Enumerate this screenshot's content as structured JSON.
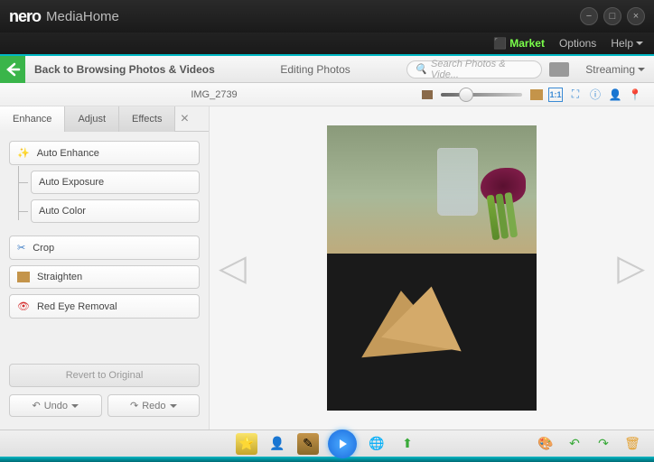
{
  "app": {
    "brand": "nero",
    "name": "MediaHome"
  },
  "menu": {
    "market": "Market",
    "options": "Options",
    "help": "Help"
  },
  "nav": {
    "back": "Back to Browsing Photos & Videos",
    "title": "Editing Photos",
    "search_placeholder": "Search Photos & Vide...",
    "streaming": "Streaming"
  },
  "file": {
    "name": "IMG_2739"
  },
  "tabs": {
    "enhance": "Enhance",
    "adjust": "Adjust",
    "effects": "Effects"
  },
  "tools": {
    "auto_enhance": "Auto Enhance",
    "auto_exposure": "Auto Exposure",
    "auto_color": "Auto Color",
    "crop": "Crop",
    "straighten": "Straighten",
    "red_eye": "Red Eye Removal"
  },
  "actions": {
    "revert": "Revert to Original",
    "undo": "Undo",
    "redo": "Redo"
  }
}
